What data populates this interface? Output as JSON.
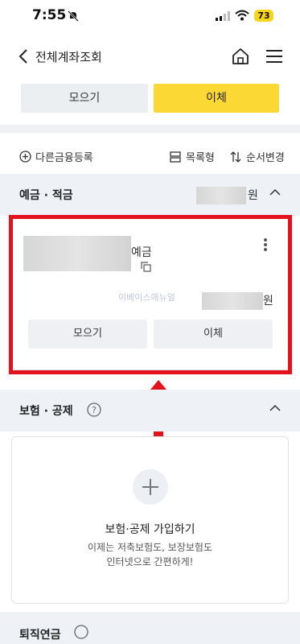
{
  "status_bar": {
    "time": "7:55",
    "battery": "73"
  },
  "header": {
    "title": "전체계좌조회"
  },
  "top_buttons": {
    "gather": "모으기",
    "transfer": "이체"
  },
  "toolbar": {
    "add_other": "다른금융등록",
    "list_view": "목록형",
    "reorder": "순서변경"
  },
  "deposit_section": {
    "title": "예금 · 적금",
    "currency": "원"
  },
  "account_card": {
    "name_suffix": "예금",
    "watermark": "이베이스매뉴얼",
    "currency": "원",
    "gather_button": "모으기",
    "transfer_button": "이체"
  },
  "insurance_section": {
    "title": "보험 · 공제"
  },
  "insurance_card": {
    "title": "보험·공제 가입하기",
    "desc_line1": "이제는 저축보험도, 보장보험도",
    "desc_line2": "인터넷으로 간편하게!"
  },
  "pension_section": {
    "title": "퇴직연금"
  },
  "colors": {
    "accent_yellow": "#fcd834",
    "highlight_red": "#e4121a",
    "section_bg": "#eef2f7"
  }
}
